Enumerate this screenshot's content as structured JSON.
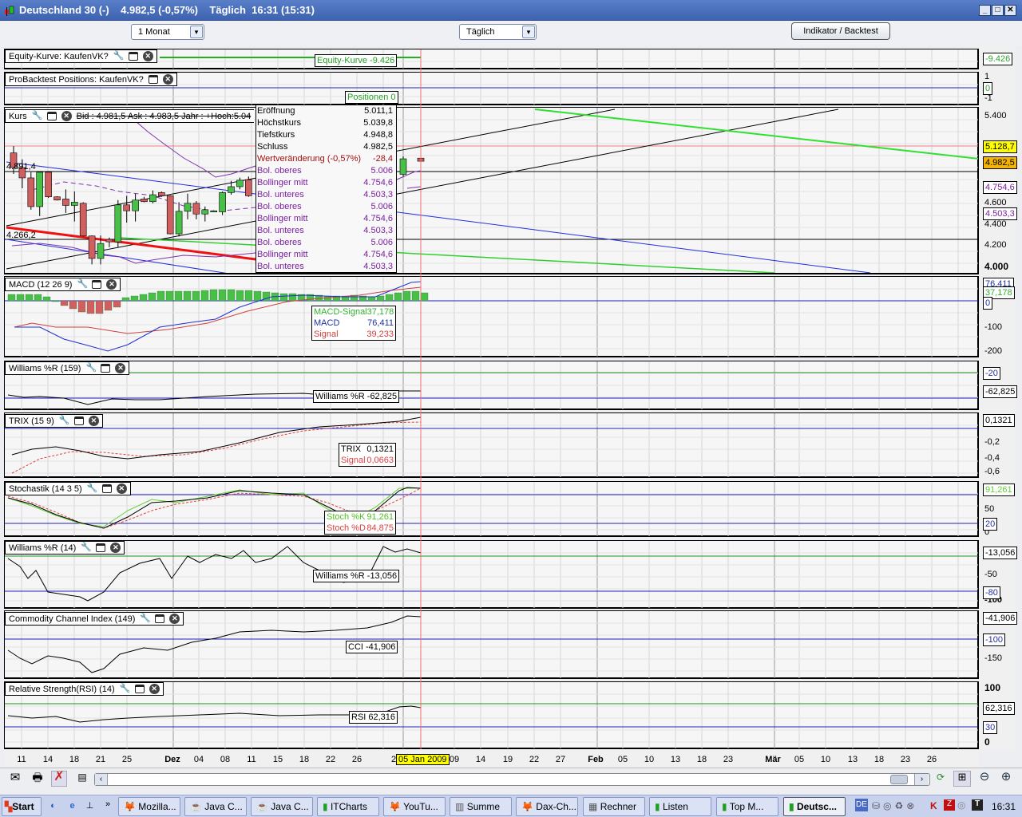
{
  "window": {
    "title": "Deutschland 30 (-)    4.982,5 (-0,57%)    Täglich  16:31 (15:31)",
    "minimize": "_",
    "maximize": "□",
    "close": "✕"
  },
  "toolbar": {
    "period": "1 Monat",
    "interval": "Täglich",
    "indicator_button": "Indikator / Backtest"
  },
  "panels": {
    "equity": {
      "title": "Equity-Kurve: KaufenVK?",
      "legend": "Equity-Kurve -9.426",
      "axis_value": "-9.426"
    },
    "positions": {
      "title": "ProBacktest Positions: KaufenVK?",
      "legend": "Positionen 0",
      "axis_ticks": [
        "1",
        "-1"
      ],
      "axis_value": "0"
    },
    "price": {
      "title": "Kurs",
      "quote": "Bid : 4.981,5 Ask : 4.983,5  Jahr : +Hoch:5.04",
      "level_high": "4.891,4",
      "level_low": "4.266,2",
      "axis_ticks": [
        "5.400",
        "4.600",
        "4.400",
        "4.200",
        "4.000"
      ],
      "axis_values": {
        "last_high": "5.128,7",
        "close": "4.982,5",
        "bol_mid": "4.754,6",
        "bol_low": "4.503,3"
      },
      "candles": [
        {
          "o": 5060,
          "h": 5124,
          "l": 4864,
          "c": 4924
        },
        {
          "o": 4924,
          "h": 5000,
          "l": 4730,
          "c": 4827
        },
        {
          "o": 4827,
          "h": 4880,
          "l": 4530,
          "c": 4559
        },
        {
          "o": 4559,
          "h": 4880,
          "l": 4470,
          "c": 4880
        },
        {
          "o": 4880,
          "h": 4880,
          "l": 4640,
          "c": 4650
        },
        {
          "o": 4650,
          "h": 4655,
          "l": 4615,
          "c": 4620
        },
        {
          "o": 4630,
          "h": 4720,
          "l": 4500,
          "c": 4570
        },
        {
          "o": 4570,
          "h": 4700,
          "l": 4420,
          "c": 4600
        },
        {
          "o": 4590,
          "h": 4600,
          "l": 4280,
          "c": 4285
        },
        {
          "o": 4285,
          "h": 4290,
          "l": 4020,
          "c": 4075
        },
        {
          "o": 4075,
          "h": 4290,
          "l": 4020,
          "c": 4215
        },
        {
          "o": 4253,
          "h": 4270,
          "l": 4180,
          "c": 4230
        },
        {
          "o": 4230,
          "h": 4620,
          "l": 4180,
          "c": 4575
        },
        {
          "o": 4575,
          "h": 4660,
          "l": 4410,
          "c": 4520
        },
        {
          "o": 4520,
          "h": 4680,
          "l": 4420,
          "c": 4620
        },
        {
          "o": 4630,
          "h": 4650,
          "l": 4600,
          "c": 4605
        },
        {
          "o": 4605,
          "h": 4710,
          "l": 4590,
          "c": 4670
        },
        {
          "o": 4690,
          "h": 4700,
          "l": 4650,
          "c": 4660
        },
        {
          "o": 4660,
          "h": 4665,
          "l": 4300,
          "c": 4305
        },
        {
          "o": 4305,
          "h": 4600,
          "l": 4280,
          "c": 4515
        },
        {
          "o": 4515,
          "h": 4680,
          "l": 4440,
          "c": 4590
        },
        {
          "o": 4590,
          "h": 4610,
          "l": 4440,
          "c": 4490
        },
        {
          "o": 4490,
          "h": 4560,
          "l": 4420,
          "c": 4530
        },
        {
          "o": 4520,
          "h": 4525,
          "l": 4515,
          "c": 4520
        },
        {
          "o": 4510,
          "h": 4700,
          "l": 4480,
          "c": 4690
        },
        {
          "o": 4690,
          "h": 4800,
          "l": 4670,
          "c": 4745
        },
        {
          "o": 4745,
          "h": 4830,
          "l": 4720,
          "c": 4805
        },
        {
          "o": 4810,
          "h": 4840,
          "l": 4650,
          "c": 4660
        }
      ],
      "last_candles": [
        {
          "o": 4860,
          "h": 5030,
          "l": 4840,
          "c": 5005
        },
        {
          "o": 5011.1,
          "h": 5039.8,
          "l": 4948.8,
          "c": 4982.5
        }
      ]
    },
    "tooltip": [
      {
        "label": "Eröffnung",
        "value": "5.011,1",
        "color": "#000000"
      },
      {
        "label": "Höchstkurs",
        "value": "5.039,8",
        "color": "#000000"
      },
      {
        "label": "Tiefstkurs",
        "value": "4.948,8",
        "color": "#000000"
      },
      {
        "label": "Schluss",
        "value": "4.982,5",
        "color": "#000000"
      },
      {
        "label": "Wertveränderung (-0,57%)",
        "value": "-28,4",
        "color": "#a01010"
      },
      {
        "label": "Bol. oberes",
        "value": "5.006",
        "color": "#7a1fa0"
      },
      {
        "label": "Bollinger mitt",
        "value": "4.754,6",
        "color": "#7a1fa0"
      },
      {
        "label": "Bol. unteres",
        "value": "4.503,3",
        "color": "#7a1fa0"
      },
      {
        "label": "Bol. oberes",
        "value": "5.006",
        "color": "#7a1fa0"
      },
      {
        "label": "Bollinger mitt",
        "value": "4.754,6",
        "color": "#7a1fa0"
      },
      {
        "label": "Bol. unteres",
        "value": "4.503,3",
        "color": "#7a1fa0"
      },
      {
        "label": "Bol. oberes",
        "value": "5.006",
        "color": "#7a1fa0"
      },
      {
        "label": "Bollinger mitt",
        "value": "4.754,6",
        "color": "#7a1fa0"
      },
      {
        "label": "Bol. unteres",
        "value": "4.503,3",
        "color": "#7a1fa0"
      }
    ],
    "macd": {
      "title": "MACD (12 26 9)",
      "legend": [
        {
          "label": "MACD-Signal",
          "value": "37,178"
        },
        {
          "label": "MACD",
          "value": "76,411"
        },
        {
          "label": "Signal",
          "value": "39,233"
        }
      ],
      "axis_ticks": [
        "-100",
        "-200"
      ],
      "axis_values": [
        "76,411",
        "37,178",
        "0"
      ]
    },
    "williams159": {
      "title": "Williams %R (159)",
      "legend": "Williams %R -62,825",
      "axis_values": [
        "-20",
        "-62,825"
      ]
    },
    "trix": {
      "title": "TRIX (15 9)",
      "legend": [
        {
          "label": "TRIX",
          "value": "0,1321"
        },
        {
          "label": "Signal",
          "value": "0,0663"
        }
      ],
      "axis_ticks": [
        "-0,2",
        "-0,4",
        "-0,6"
      ],
      "axis_value": "0,1321"
    },
    "stoch": {
      "title": "Stochastik (14 3 5)",
      "legend": [
        {
          "label": "Stoch %K",
          "value": "91,261"
        },
        {
          "label": "Stoch %D",
          "value": "84,875"
        }
      ],
      "axis_ticks": [
        "50",
        "0"
      ],
      "axis_values": [
        "91,261",
        "20"
      ]
    },
    "williams14": {
      "title": "Williams %R (14)",
      "legend": "Williams %R -13,056",
      "axis_ticks": [
        "-50",
        "-100"
      ],
      "axis_values": [
        "-13,056",
        "-80"
      ]
    },
    "cci": {
      "title": "Commodity Channel Index (149)",
      "legend": "CCI -41,906",
      "axis_ticks": [
        "-150"
      ],
      "axis_values": [
        "-41,906",
        "-100"
      ]
    },
    "rsi": {
      "title": "Relative Strength(RSI) (14)",
      "legend": "RSI 62,316",
      "axis_ticks": [
        "100",
        "0"
      ],
      "axis_values": [
        "62,316",
        "30"
      ]
    }
  },
  "xaxis": {
    "labels": [
      "11",
      "14",
      "18",
      "21",
      "25",
      "Dez",
      "04",
      "08",
      "11",
      "15",
      "18",
      "22",
      "26",
      "2",
      "09",
      "14",
      "19",
      "22",
      "27",
      "Feb",
      "05",
      "10",
      "13",
      "18",
      "23",
      "Mär",
      "05",
      "10",
      "13",
      "18",
      "23",
      "26"
    ],
    "cursor_date": "05 Jan 2009"
  },
  "taskbar": {
    "start": "Start",
    "tasks": [
      "Mozilla...",
      "Java C...",
      "Java C...",
      "ITCharts",
      "YouTu...",
      "Summe",
      "Dax-Ch...",
      "Rechner",
      "Listen",
      "Top M...",
      "Deutsc..."
    ],
    "lang": "DE",
    "clock": "16:31"
  }
}
